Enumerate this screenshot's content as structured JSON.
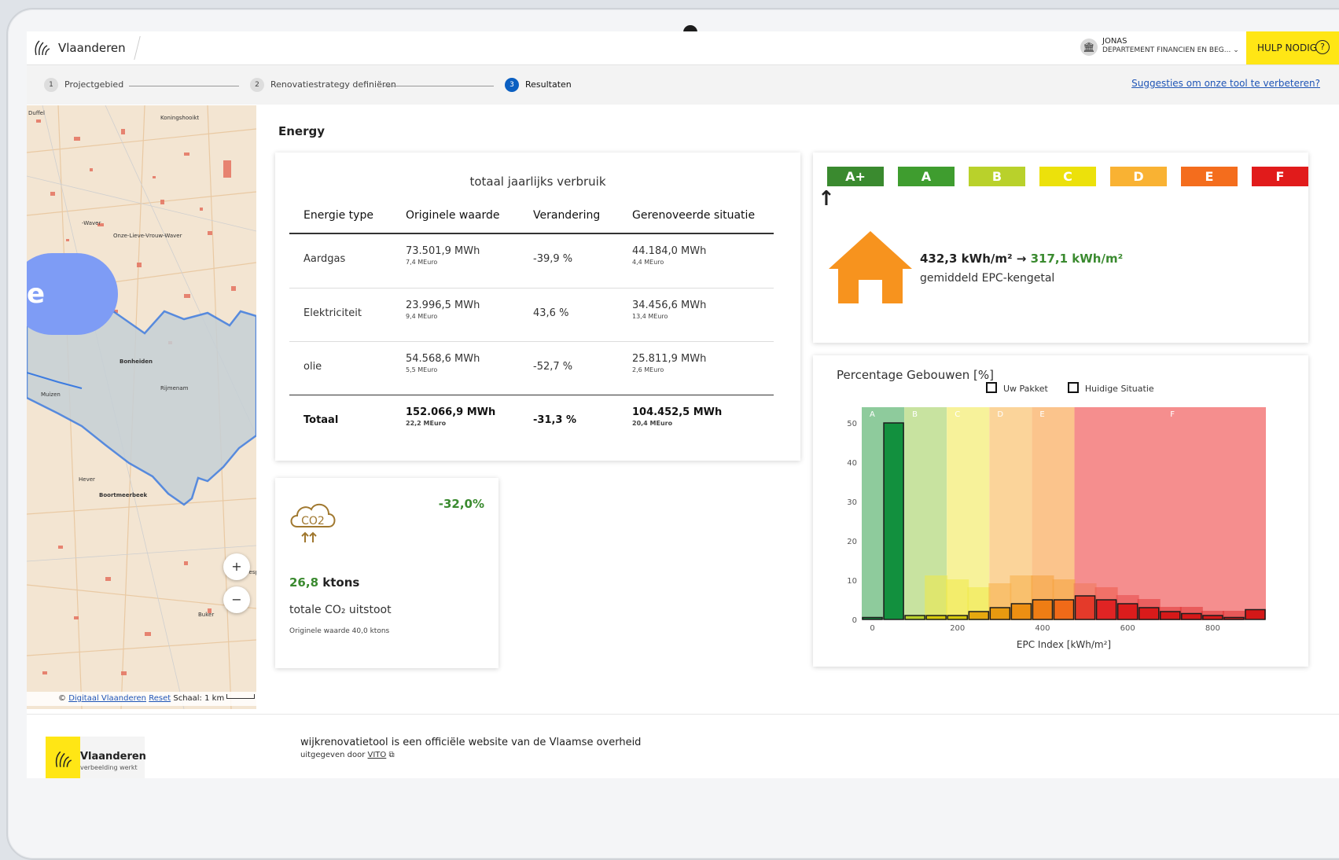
{
  "header": {
    "brand": "Vlaanderen",
    "user_name": "JONAS",
    "user_dept": "DEPARTEMENT FINANCIEN EN BEG...",
    "help_label": "HULP NODIG",
    "help_icon": "question-circle-icon"
  },
  "steps": [
    {
      "num": "1",
      "label": "Projectgebied"
    },
    {
      "num": "2",
      "label": "Renovatiestrategy definiëren"
    },
    {
      "num": "3",
      "label": "Resultaten"
    }
  ],
  "suggest_link": "Suggesties om onze tool te verbeteren?",
  "map": {
    "places": [
      "Duffel",
      "Koningshooikt",
      "Onze-Lieve-Vrouw-Waver",
      "-Waver",
      "Bonheiden",
      "Rijmenam",
      "Muizen",
      "Hever",
      "Boortmeerbeek",
      "Wesp",
      "Buker"
    ],
    "attribution_link": "Digitaal Vlaanderen",
    "reset": "Reset",
    "scale": "Schaal: 1 km",
    "zoom_in": "+",
    "zoom_out": "−",
    "copyright": "©"
  },
  "bubble_text": "e",
  "section_title": "Energy",
  "consumption": {
    "title": "totaal jaarlijks verbruik",
    "headers": [
      "Energie type",
      "Originele waarde",
      "Verandering",
      "Gerenoveerde situatie"
    ],
    "rows": [
      {
        "type": "Aardgas",
        "orig": "73.501,9 MWh",
        "orig_sub": "7,4 MEuro",
        "change": "-39,9 %",
        "new": "44.184,0 MWh",
        "new_sub": "4,4 MEuro"
      },
      {
        "type": "Elektriciteit",
        "orig": "23.996,5 MWh",
        "orig_sub": "9,4 MEuro",
        "change": "43,6 %",
        "new": "34.456,6 MWh",
        "new_sub": "13,4 MEuro"
      },
      {
        "type": "olie",
        "orig": "54.568,6 MWh",
        "orig_sub": "5,5 MEuro",
        "change": "-52,7 %",
        "new": "25.811,9 MWh",
        "new_sub": "2,6 MEuro"
      }
    ],
    "total": {
      "type": "Totaal",
      "orig": "152.066,9 MWh",
      "orig_sub": "22,2 MEuro",
      "change": "-31,3 %",
      "new": "104.452,5 MWh",
      "new_sub": "20,4 MEuro"
    }
  },
  "co2": {
    "pct": "-32,0%",
    "value": "26,8",
    "unit": "ktons",
    "label": "totale CO₂ uitstoot",
    "orig": "Originele waarde 40,0 ktons",
    "icon": "co2-cloud-icon",
    "icon_text": "CO2",
    "color": "#a0782f"
  },
  "epc": {
    "labels": [
      {
        "t": "A+",
        "c": "#3a8a2f"
      },
      {
        "t": "A",
        "c": "#3f9d2f"
      },
      {
        "t": "B",
        "c": "#b9d12b"
      },
      {
        "t": "C",
        "c": "#ece10b"
      },
      {
        "t": "D",
        "c": "#f9b233"
      },
      {
        "t": "E",
        "c": "#f46d1d"
      },
      {
        "t": "F",
        "c": "#e11b1b"
      }
    ],
    "arrow": "↑",
    "old": "432,3 kWh/m²",
    "arrow_right": "→",
    "new": "317,1 kWh/m²",
    "sub": "gemiddeld EPC-kengetal",
    "house_color": "#f7931e"
  },
  "chart_data": {
    "type": "bar",
    "title": "Percentage Gebouwen [%]",
    "xlabel": "EPC Index [kWh/m²]",
    "ylabel": "",
    "xlim": [
      -25,
      925
    ],
    "ylim": [
      0,
      54
    ],
    "xticks": [
      0,
      200,
      400,
      600,
      800
    ],
    "yticks": [
      0,
      10,
      20,
      30,
      40,
      50
    ],
    "bands": [
      {
        "label": "A",
        "from": -25,
        "to": 75,
        "color": "#8ecb9c"
      },
      {
        "label": "B",
        "from": 75,
        "to": 175,
        "color": "#c8e3a0"
      },
      {
        "label": "C",
        "from": 175,
        "to": 275,
        "color": "#f7f29a"
      },
      {
        "label": "D",
        "from": 275,
        "to": 375,
        "color": "#fbd49a"
      },
      {
        "label": "E",
        "from": 375,
        "to": 475,
        "color": "#fbc48c"
      },
      {
        "label": "F",
        "from": 475,
        "to": 925,
        "color": "#f58e8e"
      }
    ],
    "bin_width": 50,
    "bin_starts": [
      -25,
      25,
      75,
      125,
      175,
      225,
      275,
      325,
      375,
      425,
      475,
      525,
      575,
      625,
      675,
      725,
      775,
      825,
      875
    ],
    "series": [
      {
        "name": "Huidige Situatie",
        "values": [
          0,
          0,
          1,
          11,
          10,
          8,
          9,
          11,
          11,
          10,
          9,
          8,
          6,
          5,
          3,
          3,
          2,
          2,
          0
        ],
        "colors": [
          "#1f9d4a",
          "#1f9d4a",
          "#a8d36a",
          "#f1ea48",
          "#f1ea48",
          "#f1ea48",
          "#f9b04a",
          "#f9b04a",
          "#f7a13a",
          "#f7a13a",
          "#f07a5a",
          "#ee5a4a",
          "#e84848",
          "#e43a3a",
          "#e03232",
          "#e03232",
          "#dd2e2e",
          "#dd2e2e",
          "#dd2e2e"
        ]
      },
      {
        "name": "Uw Pakket",
        "values": [
          0.5,
          50,
          1,
          1,
          1,
          2,
          3,
          4,
          5,
          5,
          6,
          5,
          4,
          3,
          2,
          1.5,
          1,
          0.5,
          2.5
        ],
        "colors": [
          "#0f8a3a",
          "#12903e",
          "#b9d12b",
          "#d6c80a",
          "#d6c80a",
          "#e6a90f",
          "#e89a10",
          "#ed8f12",
          "#ef7d14",
          "#f06a18",
          "#e43a2a",
          "#e02424",
          "#dc1c1c",
          "#da1a1a",
          "#d71919",
          "#d61818",
          "#d41818",
          "#d41818",
          "#d41818"
        ]
      }
    ]
  },
  "footer": {
    "brand": "Vlaanderen",
    "tagline": "verbeelding werkt",
    "line1": "wijkrenovatietool is een officiële website van de Vlaamse overheid",
    "line2_prefix": "uitgegeven door",
    "line2_link": "VITO"
  }
}
